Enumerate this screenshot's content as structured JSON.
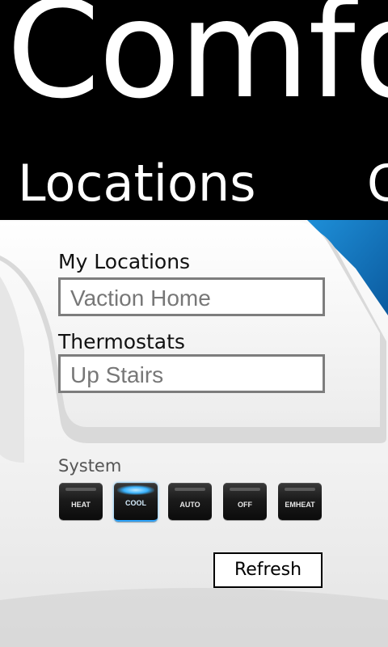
{
  "app": {
    "title": "Comfort"
  },
  "pivot": {
    "current": "Locations",
    "next": "C"
  },
  "locations": {
    "label": "My Locations",
    "value": "Vaction Home"
  },
  "thermostats": {
    "label": "Thermostats",
    "value": "Up Stairs"
  },
  "system": {
    "label": "System",
    "modes": [
      "HEAT",
      "COOL",
      "AUTO",
      "OFF",
      "EMHEAT"
    ],
    "selected": "COOL"
  },
  "actions": {
    "refresh_label": "Refresh"
  },
  "colors": {
    "accent": "#2da6ff",
    "header_bg": "#000000",
    "panel_bg": "#f4f4f4"
  }
}
